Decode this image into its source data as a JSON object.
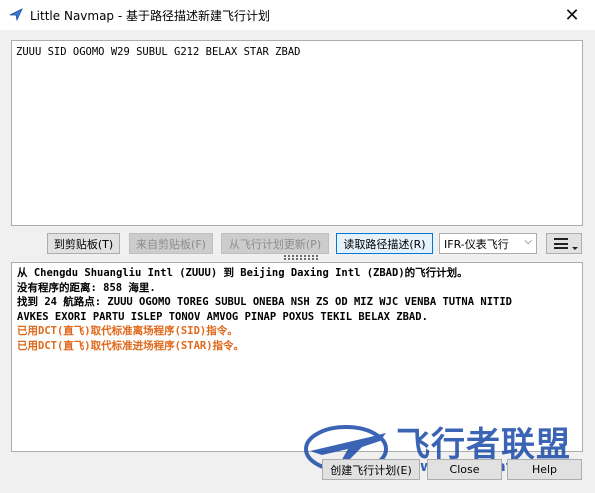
{
  "window": {
    "title": "Little Navmap - 基于路径描述新建飞行计划"
  },
  "route_input": {
    "value": "ZUUU SID OGOMO W29 SUBUL G212 BELAX STAR ZBAD"
  },
  "toolbar": {
    "to_clipboard": "到剪贴板(T)",
    "from_clipboard": "来自剪贴板(F)",
    "update_from_plan": "从飞行计划更新(P)",
    "read_route": "读取路径描述(R)",
    "flight_type": "IFR-仪表飞行",
    "menu_icon": "hamburger-menu-icon"
  },
  "log": {
    "lines": [
      "从 Chengdu Shuangliu Intl (ZUUU) 到 Beijing Daxing Intl (ZBAD)的飞行计划。",
      "没有程序的距离: 858 海里.",
      "找到 24 航路点: ZUUU OGOMO TOREG SUBUL ONEBA NSH ZS OD MIZ WJC VENBA TUTNA NITID",
      "AVKES EXORI PARTU ISLEP TONOV AMVOG PINAP POXUS TEKIL BELAX ZBAD.",
      "已用DCT(直飞)取代标准离场程序(SID)指令。",
      "已用DCT(直飞)取代标准进场程序(STAR)指令。"
    ],
    "warn_color": "#e0681a"
  },
  "footer": {
    "create_plan": "创建飞行计划(E)",
    "close": "Close",
    "help": "Help"
  },
  "watermark": {
    "text": "飞行者联盟",
    "url": "www.chinaflier.com",
    "color": "#1a4aa8"
  }
}
